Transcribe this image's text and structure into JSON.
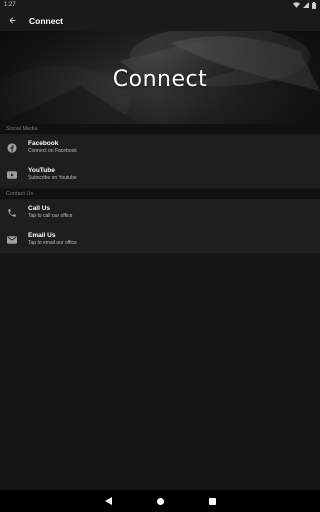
{
  "status_bar": {
    "time": "1:27",
    "icons": [
      "wifi-icon",
      "signal-icon",
      "battery-icon"
    ]
  },
  "app_bar": {
    "title": "Connect",
    "back_icon": "arrow-back-icon"
  },
  "hero": {
    "title": "Connect"
  },
  "sections": [
    {
      "header": "Social Media",
      "items": [
        {
          "title": "Facebook",
          "subtitle": "Connect on Facebook",
          "icon": "facebook-icon"
        },
        {
          "title": "YouTube",
          "subtitle": "Subscribe on Youtube",
          "icon": "youtube-icon"
        }
      ]
    },
    {
      "header": "Contact Us",
      "items": [
        {
          "title": "Call Us",
          "subtitle": "Tap to call our office",
          "icon": "phone-icon"
        },
        {
          "title": "Email Us",
          "subtitle": "Tap to email our office",
          "icon": "email-icon"
        }
      ]
    }
  ],
  "nav_bar": {
    "buttons": [
      "back-triangle-icon",
      "home-circle-icon",
      "recents-square-icon"
    ]
  }
}
